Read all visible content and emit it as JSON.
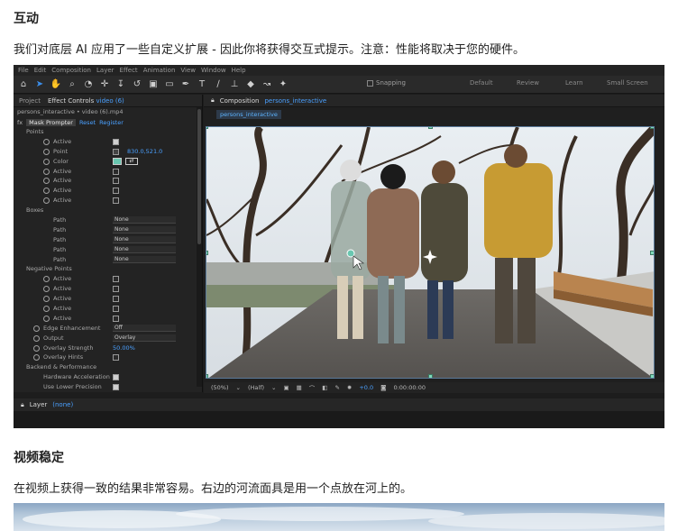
{
  "section1": {
    "title": "互动",
    "text": "我们对底层 AI 应用了一些自定义扩展 - 因此你将获得交互式提示。注意：性能将取决于您的硬件。"
  },
  "ae": {
    "menu": [
      "File",
      "Edit",
      "Composition",
      "Layer",
      "Effect",
      "Animation",
      "View",
      "Window",
      "Help"
    ],
    "snapping_label": "Snapping",
    "workspaces": [
      "Default",
      "Review",
      "Learn",
      "Small Screen"
    ],
    "left_panel": {
      "tab_project": "Project",
      "tab_effect_controls": "Effect Controls",
      "tab_effect_controls_target": "video (6)",
      "subtitle": "persons_interactive • video (6).mp4",
      "fx_name": "Mask Prompter",
      "reset_label": "Reset",
      "register_label": "Register",
      "groups": {
        "points": "Points",
        "boxes": "Boxes",
        "negative_points": "Negative Points",
        "backend": "Backend & Performance"
      },
      "labels": {
        "active": "Active",
        "point": "Point",
        "color": "Color",
        "path": "Path",
        "edge_enhancement": "Edge Enhancement",
        "output": "Output",
        "overlay_strength": "Overlay Strength",
        "overlay_hints": "Overlay Hints",
        "hardware_acceleration": "Hardware Acceleration",
        "use_lower_precision": "Use Lower Precision"
      },
      "values": {
        "point": "830.0,521.0",
        "path_none": "None",
        "edge_enhancement": "Off",
        "output": "Overlay",
        "overlay_strength": "50.00%"
      }
    },
    "right_panel": {
      "tab_composition": "Composition",
      "tab_composition_name": "persons_interactive",
      "comp_tab": "persons_interactive",
      "zoom": "(50%)",
      "resolution": "(Half)",
      "exposure": "+0.0",
      "timecode": "0:00:00:00"
    },
    "layer_bar": {
      "label": "Layer",
      "value": "(none)"
    }
  },
  "section2": {
    "title": "视频稳定",
    "text": "在视频上获得一致的结果非常容易。右边的河流面具是用一个点放在河上的。"
  },
  "colors": {
    "accent_blue": "#4aa0ff",
    "handle_green": "#7fd9b9",
    "mask_overlay": "#69c7b0"
  }
}
